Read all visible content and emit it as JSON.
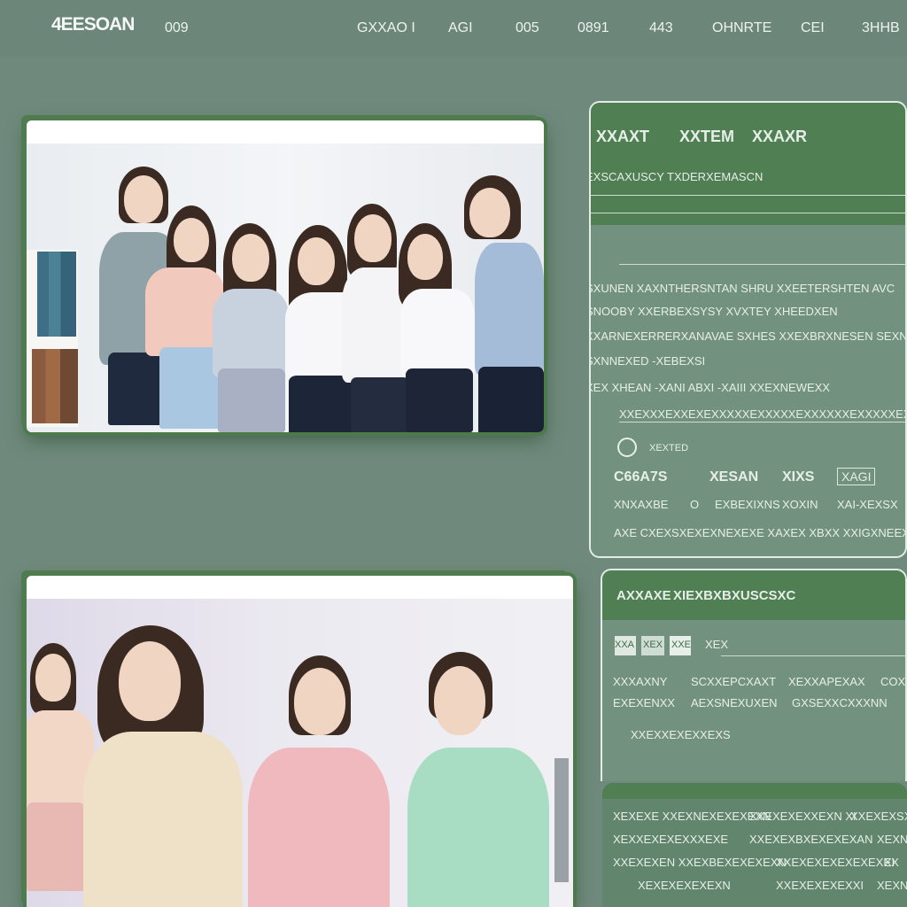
{
  "header": {
    "logo": "4EESOAN",
    "first": "009",
    "nav": [
      "GXXAO I",
      "AGI",
      "005",
      "0891",
      "443",
      "OHNRTE",
      "CEI",
      "3HHB"
    ]
  },
  "panel1": {
    "title_parts": [
      "XXAXT",
      "XXTEM",
      "XXAXR"
    ],
    "subtitle": "EXSCAXUSCY TXDERXEMASCN",
    "lines": [
      "SXUNEN  XAXNTHERSNTAN  SHRU  XXEETERSHTEN  AVC",
      "SNOOBY  XXERBEXSYSY  XVXTEY  XHEEDXEN",
      "XXARNEXERRERXANAVAE  SXHES  XXEXBRXNESEN  SEXN",
      "SXNNEXED  -XEBEXSI",
      "XEX  XHEAN  -XANI  ABXI  -XAIII  XXEXNEWEXX",
      "XXEXXXEXXEXEXXXXXEXXXXXEXXXXXXEXXXXXEXXXXX"
    ],
    "icon_label": "XEXTED",
    "stats": [
      "C66A7S",
      "XESAN",
      "XIXS",
      "XAGI"
    ],
    "row2": [
      "XNXAXBE",
      "O",
      "EXBEXIXNS",
      "XOXIN",
      "XAI-XEXSX"
    ],
    "footer": "AXE CXEXSXEXEXNEXEXE  XAXEX XBXX  XXIGXNEEX EXX"
  },
  "panel2": {
    "title_parts": [
      "AXXAXE",
      "XIEXBXBXUSCSXC"
    ],
    "badges": [
      "XXA",
      "XEX",
      "XXE"
    ],
    "badge_label": "XEX",
    "rows": [
      [
        "XXXAXNY",
        "SCXXEPCXAXT",
        "XEXXAPEXAX",
        "COX"
      ],
      [
        "EXEXENXX",
        "AEXSNEXUXEN",
        "GXSEXXCXXXNN"
      ],
      [
        "XXEXXEXEXXEXS"
      ]
    ]
  },
  "panel3": {
    "rows": [
      [
        "XEXEXE  XXEXNEXEXEXEXN",
        "XXEXEXEXXEXN  XI",
        "XXEXEXSX"
      ],
      [
        "XEXXEXEXEXXXEXE",
        "XXEXEXBXEXEXEXAN",
        "XEXN"
      ],
      [
        "XXEXEXEN  XXEXBEXEXEXEXN",
        "XXEXEXEXEXEXEXEX",
        "XI"
      ],
      [
        "XEXEXEXEXEXN",
        "XXEXEXEXEXXI",
        "XEXN"
      ]
    ]
  }
}
